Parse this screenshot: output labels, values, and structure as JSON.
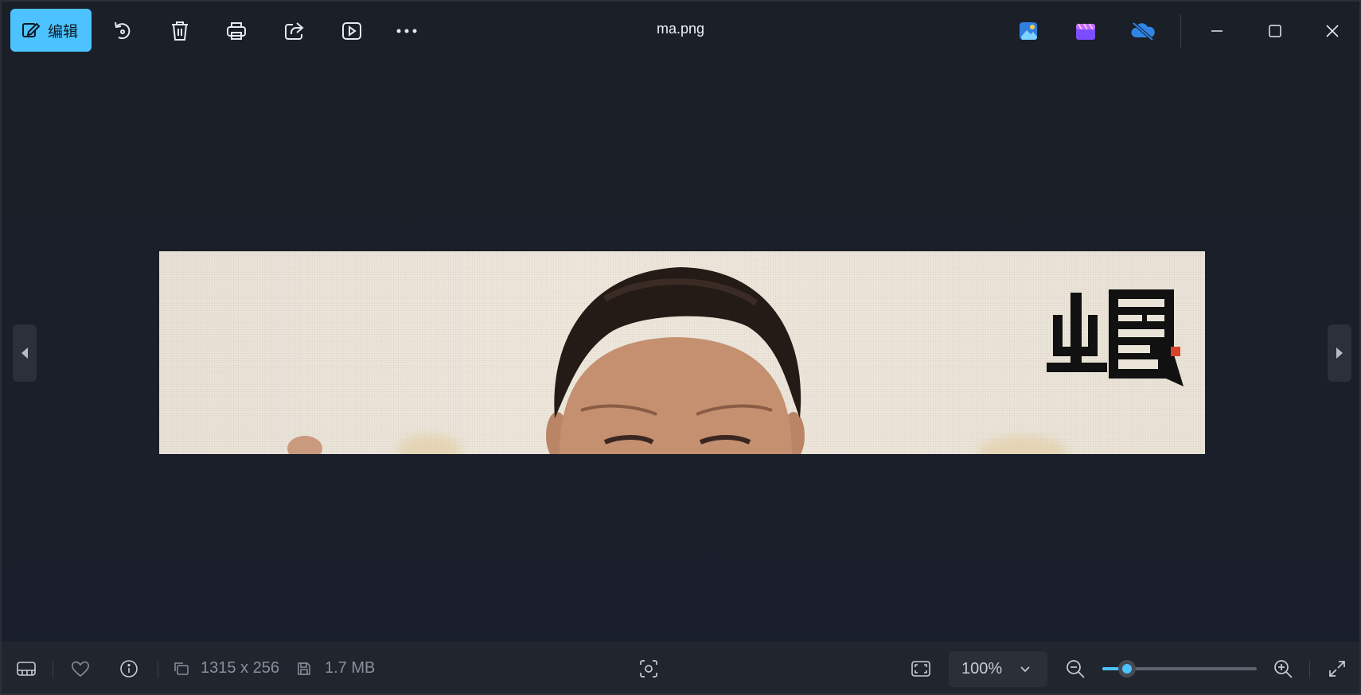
{
  "toolbar": {
    "edit_label": "编辑",
    "accent": "#4cc2ff",
    "icons": [
      "edit-pencil-icon",
      "rotate-icon",
      "delete-icon",
      "print-icon",
      "share-icon",
      "slideshow-icon",
      "more-icon"
    ]
  },
  "window": {
    "title": "ma.png",
    "app_icons": [
      "photos-app-icon",
      "clipchamp-icon",
      "onedrive-icon"
    ]
  },
  "photo": {
    "logo_text": "出圈"
  },
  "status": {
    "dimensions": "1315 x 256",
    "file_size": "1.7 MB",
    "zoom": "100%",
    "zoom_level_fraction": 0.16
  }
}
